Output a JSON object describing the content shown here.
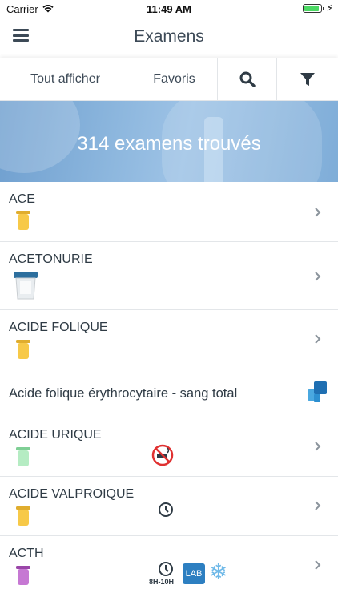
{
  "status_bar": {
    "carrier": "Carrier",
    "time": "11:49 AM",
    "battery_level": 0.8
  },
  "nav": {
    "title": "Examens"
  },
  "tabs": [
    {
      "label": "Tout afficher"
    },
    {
      "label": "Favoris"
    },
    {
      "icon": "search-icon"
    },
    {
      "icon": "filter-icon"
    }
  ],
  "banner": {
    "count_text": "314 examens trouvés"
  },
  "exams": [
    {
      "name": "ACE",
      "tube_color": "#f7c948",
      "icons": []
    },
    {
      "name": "ACETONURIE",
      "tube_type": "urine-cup-icon",
      "icons": []
    },
    {
      "name": "ACIDE FOLIQUE",
      "tube_color": "#f7c948",
      "icons": []
    },
    {
      "name": "Acide folique érythrocytaire - sang total",
      "icons": [
        "external-lab-icon"
      ]
    },
    {
      "name": "ACIDE URIQUE",
      "tube_color": "#9fe3b0",
      "icons": [
        "no-smoking-icon"
      ]
    },
    {
      "name": "ACIDE VALPROIQUE",
      "tube_color": "#f7c948",
      "icons": [
        "clock-icon"
      ]
    },
    {
      "name": "ACTH",
      "tube_color": "#b65fc4",
      "icons": [
        "clock-icon",
        "lab-icon",
        "frozen-icon"
      ],
      "clock_label": "8H-10H",
      "lab_label": "LAB"
    }
  ]
}
